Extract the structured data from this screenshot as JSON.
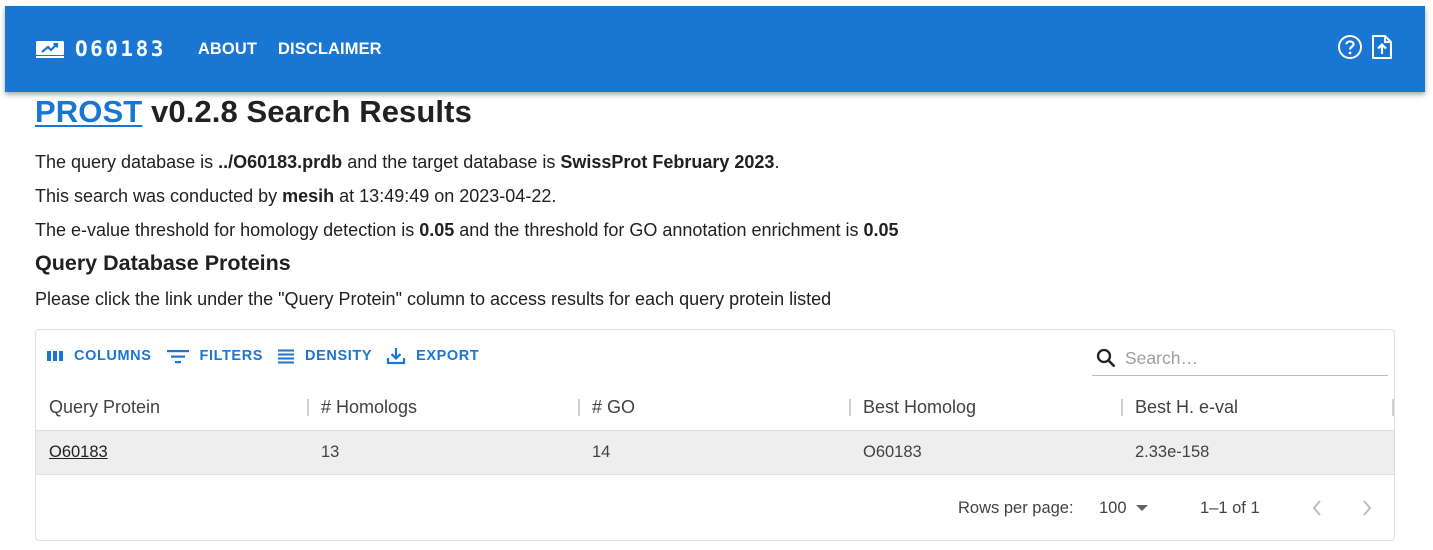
{
  "appbar": {
    "brand_icon": "chart-trending-up-icon",
    "brand_text": "O60183",
    "nav": [
      "ABOUT",
      "DISCLAIMER"
    ],
    "actions": [
      "help-circle-icon",
      "file-upload-icon"
    ],
    "color": "#1976d2"
  },
  "header": {
    "link_text": "PROST",
    "title_rest": " v0.2.8 Search Results"
  },
  "info": {
    "line1_a": "The query database is ",
    "query_db": "../O60183.prdb",
    "line1_b": " and the target database is ",
    "target_db": "SwissProt February 2023",
    "line1_c": ".",
    "line2_a": "This search was conducted by ",
    "user": "mesih",
    "line2_b": " at 13:49:49 on 2023-04-22.",
    "line3_a": "The e-value threshold for homology detection is ",
    "evalue": "0.05",
    "line3_b": " and the threshold for GO annotation enrichment is ",
    "go_threshold": "0.05"
  },
  "section": {
    "title": "Query Database Proteins",
    "note": "Please click the link under the \"Query Protein\" column to access results for each query protein listed"
  },
  "toolbar": {
    "columns": "COLUMNS",
    "filters": "FILTERS",
    "density": "DENSITY",
    "export": "EXPORT"
  },
  "search": {
    "placeholder": "Search…"
  },
  "table": {
    "columns": [
      "Query Protein",
      "# Homologs",
      "# GO",
      "Best Homolog",
      "Best H. e-val"
    ],
    "rows": [
      [
        "O60183",
        "13",
        "14",
        "O60183",
        "2.33e-158"
      ]
    ]
  },
  "footer": {
    "rows_per_page_label": "Rows per page:",
    "rows_per_page": "100",
    "range": "1–1 of 1"
  }
}
